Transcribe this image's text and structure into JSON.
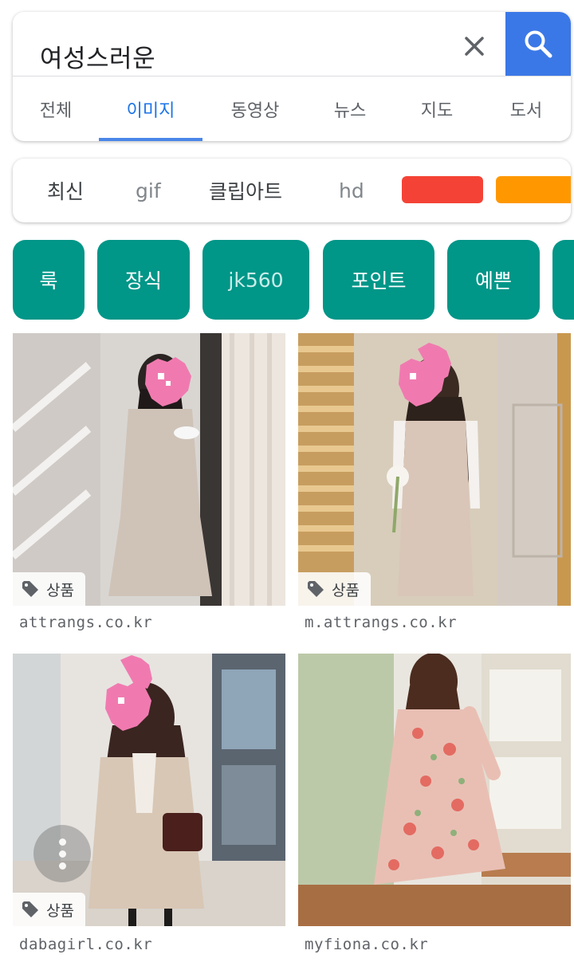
{
  "search": {
    "query": "여성스러운"
  },
  "tabs": [
    {
      "label": "전체"
    },
    {
      "label": "이미지",
      "active": true
    },
    {
      "label": "동영상"
    },
    {
      "label": "뉴스"
    },
    {
      "label": "지도"
    },
    {
      "label": "도서"
    }
  ],
  "filters": [
    {
      "label": "최신"
    },
    {
      "label": "gif"
    },
    {
      "label": "클립아트"
    },
    {
      "label": "hd"
    }
  ],
  "color_filters": [
    "#f44336",
    "#ff9800"
  ],
  "chips": [
    {
      "label": "룩"
    },
    {
      "label": "장식"
    },
    {
      "label": "jk560"
    },
    {
      "label": "포인트"
    },
    {
      "label": "예쁜"
    }
  ],
  "results": [
    {
      "badge": "상품",
      "source": "attrangs.co.kr"
    },
    {
      "badge": "상품",
      "source": "m.attrangs.co.kr"
    },
    {
      "badge": "상품",
      "source": "dabagirl.co.kr"
    },
    {
      "source": "myfiona.co.kr"
    }
  ],
  "colors": {
    "accent": "#1a73e8",
    "search_button": "#3b78e7",
    "chip": "#009688"
  }
}
